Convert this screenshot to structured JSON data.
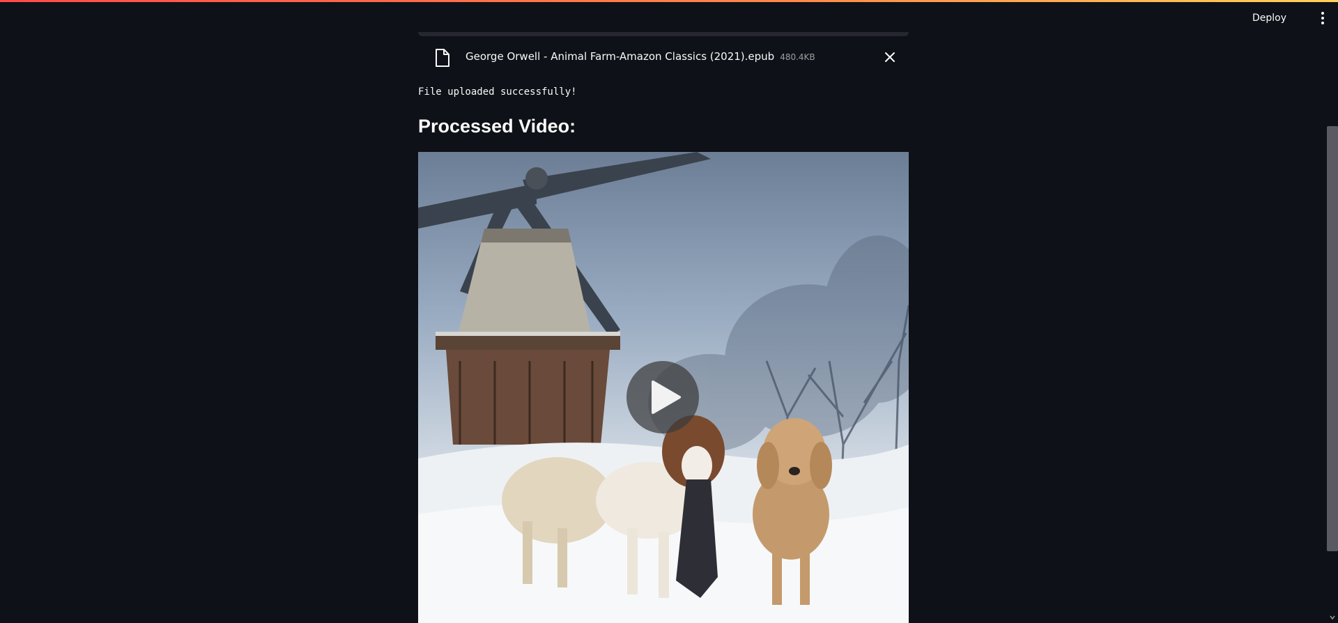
{
  "header": {
    "deploy_label": "Deploy",
    "menu_icon": "kebab-menu-icon"
  },
  "colors": {
    "background": "#0e1117",
    "accent_gradient_start": "#ff4b4b",
    "accent_gradient_end": "#ffd15a",
    "secondary_bg": "#262730",
    "text": "#fafafa"
  },
  "uploader": {
    "file_icon": "file-icon",
    "file_name": "George Orwell - Animal Farm-Amazon Classics (2021).epub",
    "file_size": "480.4KB",
    "remove_icon": "close-icon"
  },
  "status": {
    "message": "File uploaded successfully!"
  },
  "video_section": {
    "heading": "Processed Video:",
    "play_icon": "play-icon"
  }
}
